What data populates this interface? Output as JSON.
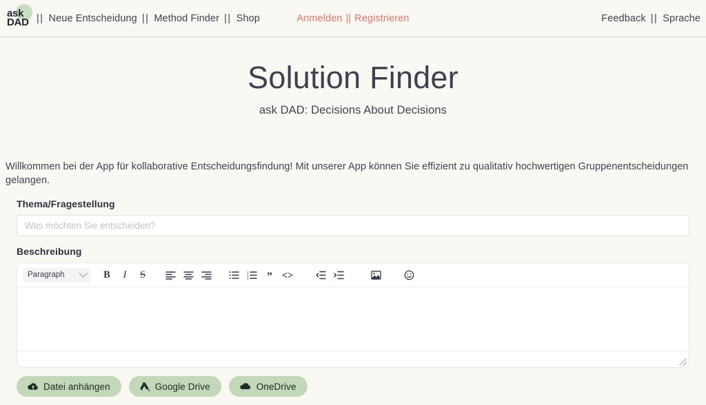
{
  "nav": {
    "logo": {
      "line1": "ask",
      "line2": "DAD"
    },
    "left_items": [
      {
        "label": "Neue Entscheidung"
      },
      {
        "label": "Method Finder"
      },
      {
        "label": "Shop"
      }
    ],
    "separator": "||",
    "auth": {
      "login_label": "Anmelden",
      "separator": "||",
      "register_label": "Registrieren",
      "color": "#e8736a"
    },
    "right_items": [
      {
        "label": "Feedback"
      },
      {
        "label": "Sprache"
      }
    ]
  },
  "hero": {
    "title": "Solution Finder",
    "subtitle": "ask DAD: Decisions About Decisions"
  },
  "intro": {
    "text": "Willkommen bei der App für kollaborative Entscheidungsfindung! Mit unserer App können Sie effizient zu qualitativ hochwertigen Gruppenentscheidungen gelangen."
  },
  "form": {
    "topic": {
      "label": "Thema/Fragestellung",
      "placeholder": "Was möchten Sie entscheiden?",
      "value": ""
    },
    "description": {
      "label": "Beschreibung",
      "value": ""
    }
  },
  "editor_toolbar": {
    "block_format": {
      "selected": "Paragraph",
      "icon": "chevron-down-icon"
    },
    "buttons": [
      {
        "name": "bold-button",
        "label": "B"
      },
      {
        "name": "italic-button",
        "label": "I"
      },
      {
        "name": "strikethrough-button",
        "label": "S"
      },
      {
        "name": "align-left-button",
        "label": ""
      },
      {
        "name": "align-center-button",
        "label": ""
      },
      {
        "name": "align-right-button",
        "label": ""
      },
      {
        "name": "bullet-list-button",
        "label": ""
      },
      {
        "name": "numbered-list-button",
        "label": ""
      },
      {
        "name": "blockquote-button",
        "label": "”"
      },
      {
        "name": "code-button",
        "label": "<>"
      },
      {
        "name": "outdent-button",
        "label": ""
      },
      {
        "name": "indent-button",
        "label": ""
      },
      {
        "name": "insert-image-button",
        "label": ""
      },
      {
        "name": "emoji-button",
        "label": ""
      }
    ]
  },
  "attachments": {
    "buttons": [
      {
        "label": "Datei anhängen",
        "icon": "cloud-upload-icon"
      },
      {
        "label": "Google Drive",
        "icon": "google-drive-icon"
      },
      {
        "label": "OneDrive",
        "icon": "cloud-icon"
      }
    ],
    "color": "#c2d8b9"
  },
  "theme": {
    "background": "#faf8f3",
    "text": "#3a4452",
    "accent": "#e8736a",
    "green": "#c2d8b9"
  }
}
